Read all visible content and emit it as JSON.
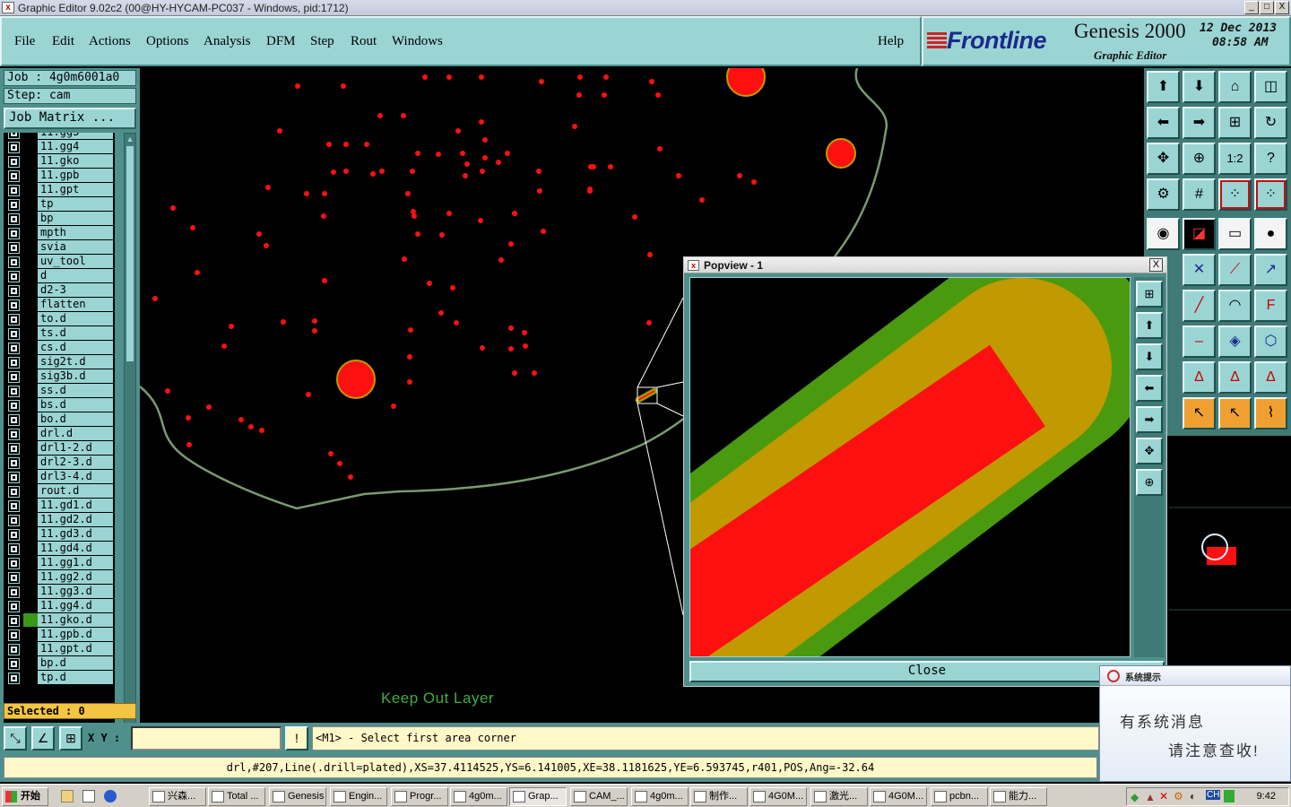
{
  "window": {
    "title": "Graphic Editor 9.02c2 (00@HY-HYCAM-PC037 - Windows, pid:1712)",
    "controls": [
      "_",
      "□",
      "X"
    ]
  },
  "menu": {
    "items": [
      "File",
      "Edit",
      "Actions",
      "Options",
      "Analysis",
      "DFM",
      "Step",
      "Rout",
      "Windows"
    ],
    "help": "Help"
  },
  "brand": {
    "logo": "Frontline",
    "product": "Genesis 2000",
    "subtitle": "Graphic Editor",
    "date": "12 Dec 2013",
    "time": "08:58 AM"
  },
  "job": {
    "job_line": "Job : 4g0m6001a0",
    "step_line": "Step: cam",
    "matrix_button": "Job Matrix ..."
  },
  "layers": [
    {
      "name": "11.gg3",
      "color": ""
    },
    {
      "name": "11.gg4",
      "color": ""
    },
    {
      "name": "11.gko",
      "color": ""
    },
    {
      "name": "11.gpb",
      "color": ""
    },
    {
      "name": "11.gpt",
      "color": ""
    },
    {
      "name": "tp",
      "color": ""
    },
    {
      "name": "bp",
      "color": ""
    },
    {
      "name": "mpth",
      "color": ""
    },
    {
      "name": "svia",
      "color": ""
    },
    {
      "name": "uv_tool",
      "color": ""
    },
    {
      "name": "d",
      "color": ""
    },
    {
      "name": "d2-3",
      "color": ""
    },
    {
      "name": "flatten",
      "color": ""
    },
    {
      "name": "to.d",
      "color": ""
    },
    {
      "name": "ts.d",
      "color": ""
    },
    {
      "name": "cs.d",
      "color": ""
    },
    {
      "name": "sig2t.d",
      "color": ""
    },
    {
      "name": "sig3b.d",
      "color": ""
    },
    {
      "name": "ss.d",
      "color": ""
    },
    {
      "name": "bs.d",
      "color": ""
    },
    {
      "name": "bo.d",
      "color": ""
    },
    {
      "name": "drl.d",
      "color": ""
    },
    {
      "name": "drl1-2.d",
      "color": ""
    },
    {
      "name": "drl2-3.d",
      "color": ""
    },
    {
      "name": "drl3-4.d",
      "color": ""
    },
    {
      "name": "rout.d",
      "color": ""
    },
    {
      "name": "11.gd1.d",
      "color": ""
    },
    {
      "name": "11.gd2.d",
      "color": ""
    },
    {
      "name": "11.gd3.d",
      "color": ""
    },
    {
      "name": "11.gd4.d",
      "color": ""
    },
    {
      "name": "11.gg1.d",
      "color": ""
    },
    {
      "name": "11.gg2.d",
      "color": ""
    },
    {
      "name": "11.gg3.d",
      "color": ""
    },
    {
      "name": "11.gg4.d",
      "color": ""
    },
    {
      "name": "11.gko.d",
      "color": "#3a9a18"
    },
    {
      "name": "11.gpb.d",
      "color": ""
    },
    {
      "name": "11.gpt.d",
      "color": ""
    },
    {
      "name": "bp.d",
      "color": ""
    },
    {
      "name": "tp.d",
      "color": ""
    }
  ],
  "selected": "Selected : 0",
  "canvas": {
    "layer_label": "Keep Out Layer",
    "colors": {
      "board_outline": "#7a9a70",
      "drill": "#ff1010",
      "feature_mid": "#c09a00",
      "feature_outer": "#4a9a10"
    }
  },
  "popview": {
    "title": "Popview - 1",
    "close_label": "Close",
    "close_x": "X"
  },
  "coords": {
    "xy_label": "X Y :",
    "xy_value": "",
    "prompt": "<M1> - Select first area corner",
    "info_button": "!"
  },
  "status": "drl,#207,Line(.drill=plated),XS=37.4114525,YS=6.141005,XE=38.1181625,YE=6.593745,r401,POS,Ang=-32.64",
  "notification": {
    "title": "系统提示",
    "line1": "有系统消息",
    "line2": "请注意查收!"
  },
  "taskbar": {
    "start": "开始",
    "items": [
      {
        "label": "兴森..."
      },
      {
        "label": "Total ..."
      },
      {
        "label": "Genesis"
      },
      {
        "label": "Engin..."
      },
      {
        "label": "Progr..."
      },
      {
        "label": "4g0m..."
      },
      {
        "label": "Grap..."
      },
      {
        "label": "CAM_..."
      },
      {
        "label": "4g0m..."
      },
      {
        "label": "制作..."
      },
      {
        "label": "4G0M..."
      },
      {
        "label": "激光..."
      },
      {
        "label": "4G0M..."
      },
      {
        "label": "pcbn..."
      },
      {
        "label": "能力..."
      }
    ],
    "tray_lang": "CH",
    "clock": "9:42"
  }
}
